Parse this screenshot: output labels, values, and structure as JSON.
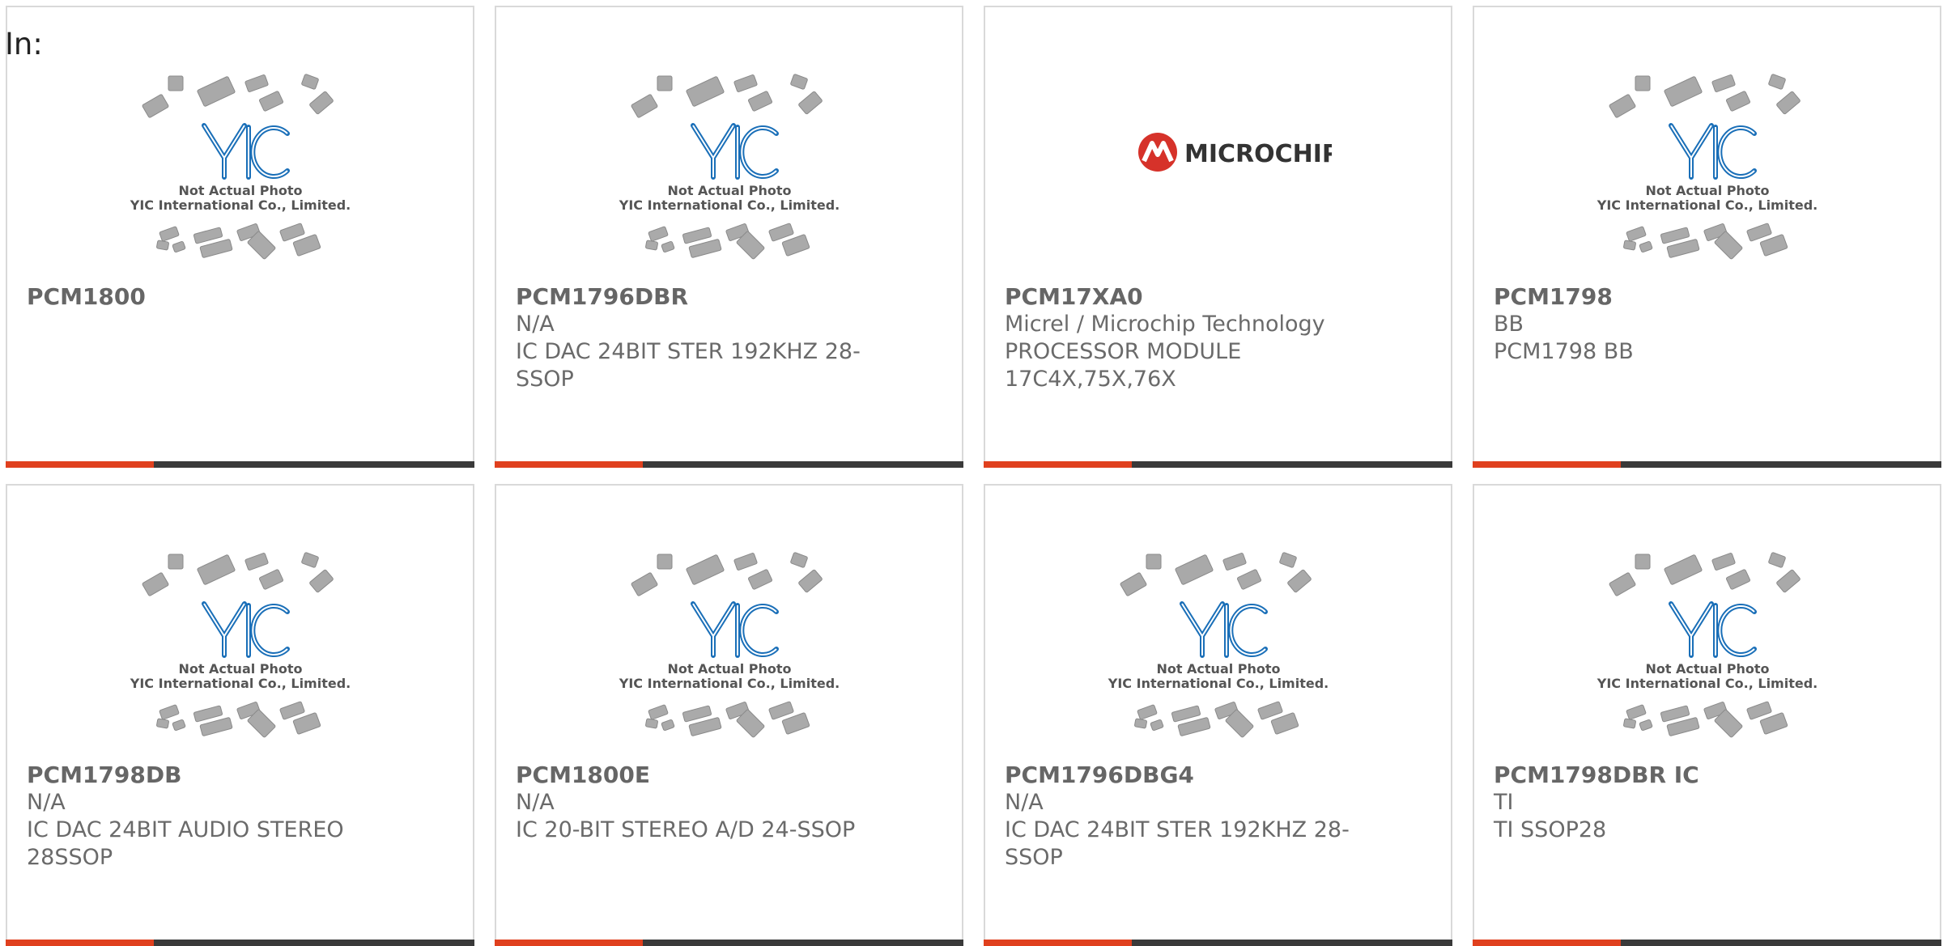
{
  "header": {
    "label": "In:"
  },
  "placeholder": {
    "line1": "Not Actual Photo",
    "line2": "YIC International Co., Limited.",
    "logo_text": "YIC"
  },
  "microchip_logo_text": "MICROCHIP",
  "colors": {
    "accent": "#e0401e",
    "bar_dark": "#3a3a3a",
    "yic_blue": "#1a6fb8",
    "microchip_red": "#d6322a"
  },
  "products": [
    {
      "part": "PCM1800",
      "image": "yic-placeholder-icon"
    },
    {
      "part": "PCM1796DBR",
      "maker": "N/A",
      "description": "IC DAC 24BIT STER 192KHZ 28-SSOP",
      "image": "yic-placeholder-icon"
    },
    {
      "part": "PCM17XA0",
      "maker": "Micrel / Microchip Technology",
      "description": "PROCESSOR MODULE 17C4X,75X,76X",
      "image": "microchip-logo-icon"
    },
    {
      "part": "PCM1798",
      "maker": "BB",
      "description": "PCM1798 BB",
      "image": "yic-placeholder-icon"
    },
    {
      "part": "PCM1798DB",
      "maker": "N/A",
      "description": "IC DAC 24BIT AUDIO STEREO 28SSOP",
      "image": "yic-placeholder-icon"
    },
    {
      "part": "PCM1800E",
      "maker": "N/A",
      "description": "IC 20-BIT STEREO A/D 24-SSOP",
      "image": "yic-placeholder-icon"
    },
    {
      "part": "PCM1796DBG4",
      "maker": "N/A",
      "description": "IC DAC 24BIT STER 192KHZ 28-SSOP",
      "image": "yic-placeholder-icon"
    },
    {
      "part": "PCM1798DBR IC",
      "maker": "TI",
      "description": "TI SSOP28",
      "image": "yic-placeholder-icon"
    }
  ]
}
